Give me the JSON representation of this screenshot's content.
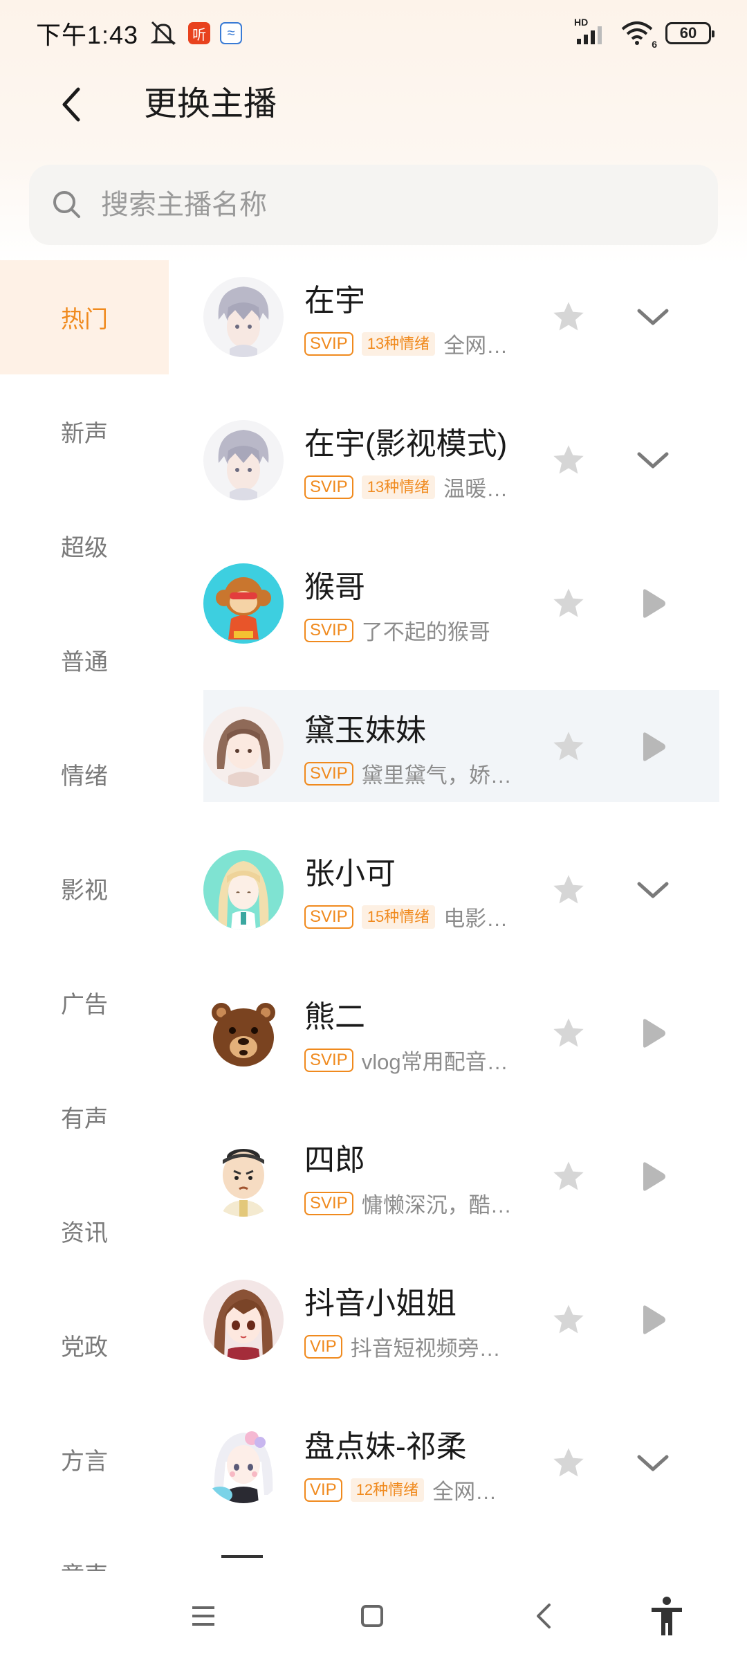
{
  "status_bar": {
    "time": "下午1:43",
    "app_badge_1": "听",
    "app_badge_2": "≈",
    "network": "HD",
    "wifi_label": "6",
    "battery": "60"
  },
  "header": {
    "title": "更换主播"
  },
  "search": {
    "placeholder": "搜索主播名称",
    "value": ""
  },
  "sidebar": {
    "items": [
      {
        "label": "热门",
        "active": true
      },
      {
        "label": "新声",
        "active": false
      },
      {
        "label": "超级",
        "active": false
      },
      {
        "label": "普通",
        "active": false
      },
      {
        "label": "情绪",
        "active": false
      },
      {
        "label": "影视",
        "active": false
      },
      {
        "label": "广告",
        "active": false
      },
      {
        "label": "有声",
        "active": false
      },
      {
        "label": "资讯",
        "active": false
      },
      {
        "label": "党政",
        "active": false
      },
      {
        "label": "方言",
        "active": false
      },
      {
        "label": "童声",
        "active": false
      }
    ]
  },
  "voices": [
    {
      "name": "在宇",
      "tier": "SVIP",
      "emotion": "13种情绪",
      "desc": "全网…",
      "action": "expand",
      "avatar": "avatar-anime-boy"
    },
    {
      "name": "在宇(影视模式)",
      "tier": "SVIP",
      "emotion": "13种情绪",
      "desc": "温暖…",
      "action": "expand",
      "avatar": "avatar-anime-boy"
    },
    {
      "name": "猴哥",
      "tier": "SVIP",
      "emotion": "",
      "desc": "了不起的猴哥",
      "action": "play",
      "avatar": "avatar-monkey"
    },
    {
      "name": "黛玉妹妹",
      "tier": "SVIP",
      "emotion": "",
      "desc": "黛里黛气，娇…",
      "action": "play",
      "avatar": "avatar-anime-girl"
    },
    {
      "name": "张小可",
      "tier": "SVIP",
      "emotion": "15种情绪",
      "desc": "电影…",
      "action": "expand",
      "avatar": "avatar-blonde-girl"
    },
    {
      "name": "熊二",
      "tier": "SVIP",
      "emotion": "",
      "desc": "vlog常用配音…",
      "action": "play",
      "avatar": "avatar-bear"
    },
    {
      "name": "四郎",
      "tier": "SVIP",
      "emotion": "",
      "desc": "慵懒深沉，酷…",
      "action": "play",
      "avatar": "avatar-emperor"
    },
    {
      "name": "抖音小姐姐",
      "tier": "VIP",
      "emotion": "",
      "desc": "抖音短视频旁…",
      "action": "play",
      "avatar": "avatar-brown-hair-girl"
    },
    {
      "name": "盘点妹-祁柔",
      "tier": "VIP",
      "emotion": "12种情绪",
      "desc": "全网…",
      "action": "expand",
      "avatar": "avatar-white-hair-girl"
    }
  ],
  "colors": {
    "accent": "#f08a1e",
    "sidebar_active_bg": "#fef1e6",
    "icon_gray": "#d6d6d6",
    "play_gray": "#b8b8b8"
  },
  "nav": [
    "menu-icon",
    "home-icon",
    "back-icon",
    "accessibility-icon"
  ]
}
